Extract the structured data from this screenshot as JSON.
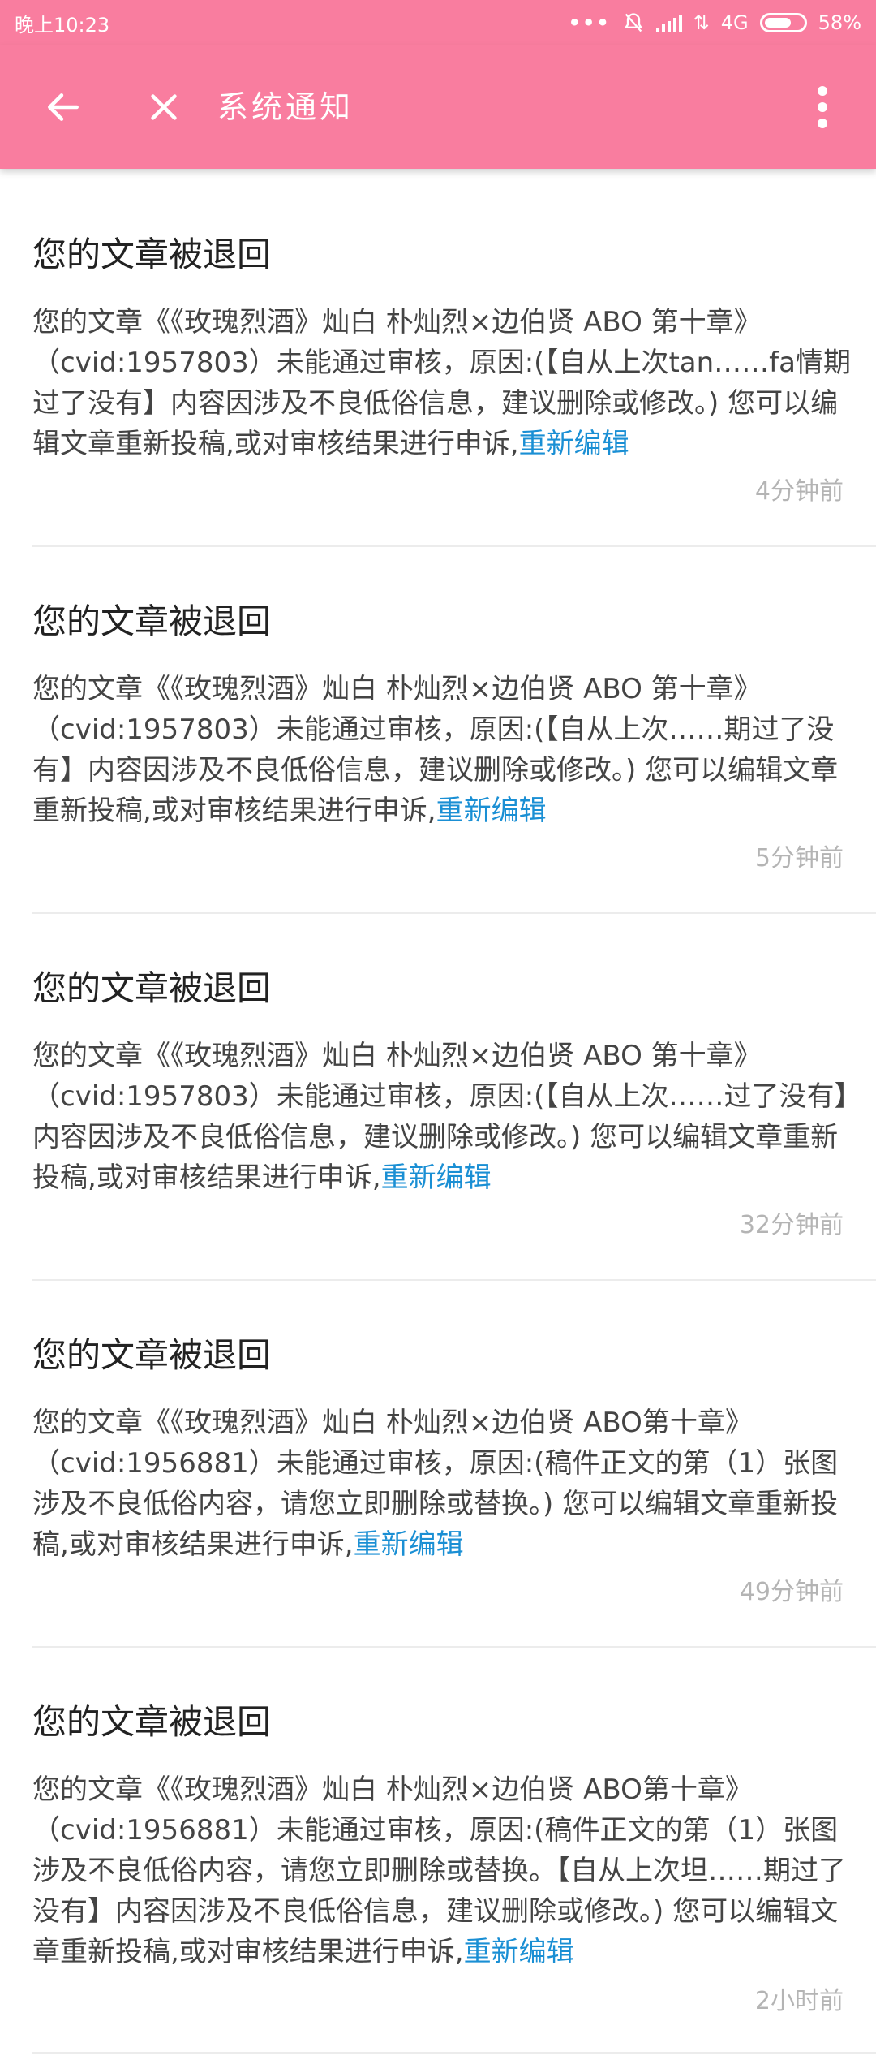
{
  "status_bar": {
    "time": "晚上10:23",
    "network": "4G",
    "battery": "58%",
    "battery_level": 0.58,
    "icons": [
      "more-dots-icon",
      "bell-off-icon",
      "signal-icon",
      "data-transfer-icon",
      "battery-icon"
    ]
  },
  "app_bar": {
    "title": "系统通知",
    "icons": [
      "back-arrow-icon",
      "close-icon",
      "more-vert-icon"
    ],
    "color": "#f97d9f"
  },
  "notifications": [
    {
      "title": "您的文章被退回",
      "body": "您的文章《《玫瑰烈酒》灿白 朴灿烈×边伯贤 ABO 第十章》（cvid:1957803）未能通过审核，原因:(【自从上次tan……fa情期过了没有】内容因涉及不良低俗信息，建议删除或修改。) 您可以编辑文章重新投稿,或对审核结果进行申诉,",
      "link": "重新编辑",
      "time": "4分钟前"
    },
    {
      "title": "您的文章被退回",
      "body": "您的文章《《玫瑰烈酒》灿白 朴灿烈×边伯贤 ABO 第十章》（cvid:1957803）未能通过审核，原因:(【自从上次……期过了没有】内容因涉及不良低俗信息，建议删除或修改。) 您可以编辑文章重新投稿,或对审核结果进行申诉,",
      "link": "重新编辑",
      "time": "5分钟前"
    },
    {
      "title": "您的文章被退回",
      "body": "您的文章《《玫瑰烈酒》灿白 朴灿烈×边伯贤 ABO 第十章》（cvid:1957803）未能通过审核，原因:(【自从上次……过了没有】内容因涉及不良低俗信息，建议删除或修改。) 您可以编辑文章重新投稿,或对审核结果进行申诉,",
      "link": "重新编辑",
      "time": "32分钟前"
    },
    {
      "title": "您的文章被退回",
      "body": "您的文章《《玫瑰烈酒》灿白 朴灿烈×边伯贤 ABO第十章》（cvid:1956881）未能通过审核，原因:(稿件正文的第（1）张图涉及不良低俗内容，请您立即删除或替换。) 您可以编辑文章重新投稿,或对审核结果进行申诉,",
      "link": "重新编辑",
      "time": "49分钟前"
    },
    {
      "title": "您的文章被退回",
      "body": "您的文章《《玫瑰烈酒》灿白 朴灿烈×边伯贤 ABO第十章》（cvid:1956881）未能通过审核，原因:(稿件正文的第（1）张图涉及不良低俗内容，请您立即删除或替换。【自从上次坦……期过了没有】内容因涉及不良低俗信息，建议删除或修改。) 您可以编辑文章重新投稿,或对审核结果进行申诉,",
      "link": "重新编辑",
      "time": "2小时前"
    }
  ],
  "colors": {
    "accent": "#f97d9f",
    "link": "#1a8fd4",
    "time": "#b4b4b4"
  }
}
